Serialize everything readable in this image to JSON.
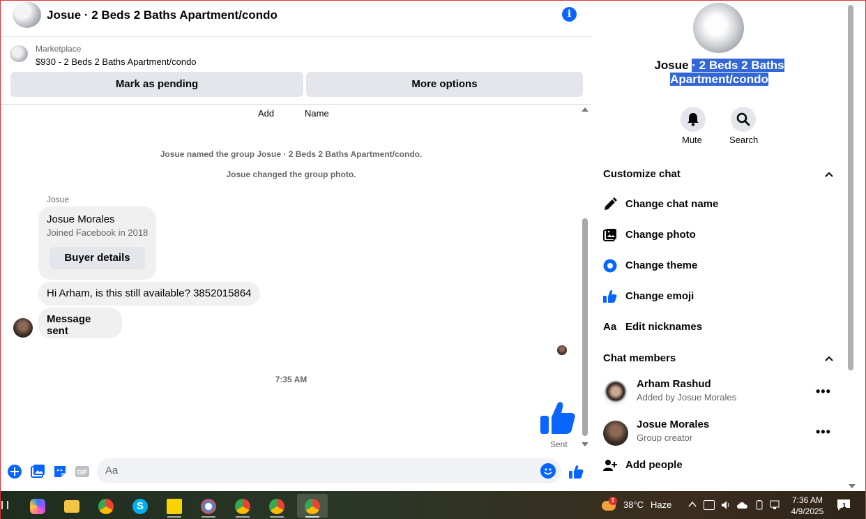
{
  "header": {
    "title": "Josue · 2 Beds 2 Baths Apartment/condo"
  },
  "marketplace": {
    "label": "Marketplace",
    "listing": "$930 - 2 Beds 2 Baths Apartment/condo",
    "mark_pending": "Mark as pending",
    "more_options": "More options"
  },
  "messages": {
    "top_add": "Add",
    "top_name": "Name",
    "system_1": "Josue named the group Josue · 2 Beds 2 Baths Apartment/condo.",
    "system_2": "Josue changed the group photo.",
    "sender": "Josue",
    "card_name": "Josue Morales",
    "card_sub": "Joined Facebook in 2018",
    "card_button": "Buyer details",
    "msg1": "Hi Arham, is this still available? 3852015864",
    "msg2": "Message sent",
    "time": "7:35 AM",
    "sent": "Sent"
  },
  "composer": {
    "placeholder": "Aa"
  },
  "info": {
    "name_plain": "Josue ",
    "name_highlight": "· 2 Beds 2 Baths Apartment/condo",
    "mute": "Mute",
    "search": "Search",
    "customize_title": "Customize chat",
    "customize_items": [
      "Change chat name",
      "Change photo",
      "Change theme",
      "Change emoji",
      "Edit nicknames"
    ],
    "members_title": "Chat members",
    "members": [
      {
        "name": "Arham Rashud",
        "sub": "Added by Josue Morales"
      },
      {
        "name": "Josue Morales",
        "sub": "Group creator"
      }
    ],
    "add_people": "Add people",
    "nickname_glyph": "Aa"
  },
  "taskbar": {
    "temperature": "38°C",
    "weather": "Haze",
    "time": "7:36 AM",
    "date": "4/9/2025",
    "notif_count": "1",
    "weather_badge": "1"
  },
  "colors": {
    "accent": "#0866ff",
    "highlight": "#3367d6"
  }
}
